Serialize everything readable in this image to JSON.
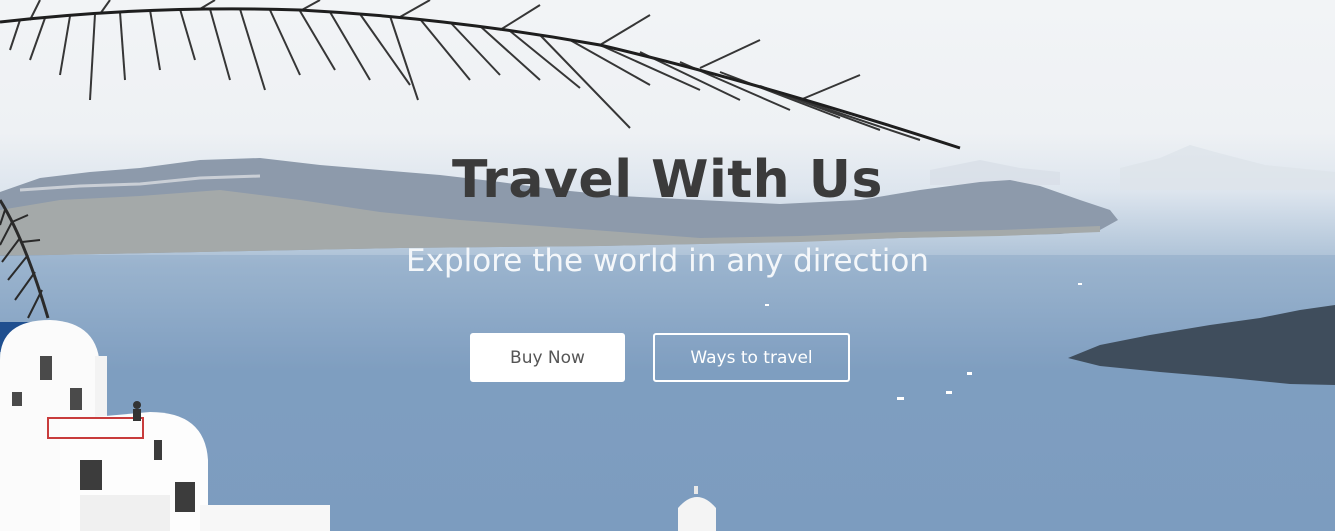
{
  "hero": {
    "title": "Travel With Us",
    "subtitle": "Explore the world in any direction",
    "buttons": {
      "buy_now": "Buy Now",
      "ways_to_travel": "Ways to travel"
    }
  },
  "colors": {
    "title": "#3b3b3b",
    "subtitle": "#f4f7fa",
    "primary_button_bg": "#ffffff",
    "primary_button_text": "#555555",
    "outline_button_border": "#ffffff"
  }
}
